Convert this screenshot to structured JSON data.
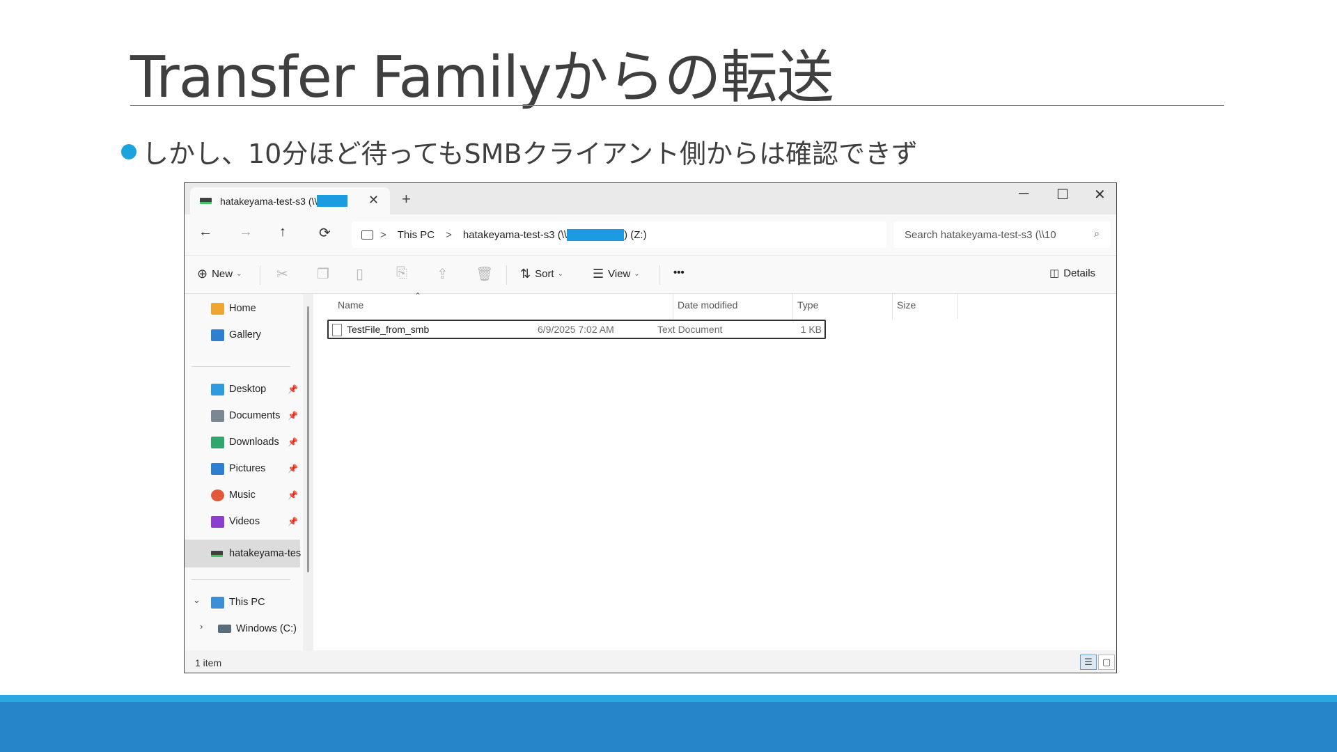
{
  "slide": {
    "title": "Transfer Familyからの転送",
    "bullet": "しかし、10分ほど待ってもSMBクライアント側からは確認できず"
  },
  "window": {
    "tab": {
      "title": "hatakeyama-test-s3 (\\\\",
      "close": "✕",
      "new_tab": "+"
    },
    "controls": {
      "minimize": "─",
      "maximize": "☐",
      "close": "✕"
    },
    "nav": {
      "back": "←",
      "forward": "→",
      "up": "↑",
      "refresh": "⟳"
    },
    "address": {
      "this_pc": "This PC",
      "separator": ">",
      "drive_prefix": "hatakeyama-test-s3 (\\\\",
      "drive_suffix": ") (Z:)"
    },
    "search": {
      "placeholder": "Search hatakeyama-test-s3 (\\\\10",
      "icon": "⌕"
    },
    "commands": {
      "new": "New",
      "sort": "Sort",
      "view": "View",
      "more": "•••",
      "details": "Details"
    },
    "sidebar": {
      "quick": [
        {
          "label": "Home",
          "icon": "home-icon",
          "color": "#f0a431"
        },
        {
          "label": "Gallery",
          "icon": "gallery-icon",
          "color": "#2f7fd0"
        }
      ],
      "pinned": [
        {
          "label": "Desktop",
          "icon": "desktop-icon",
          "color": "#2e9be0"
        },
        {
          "label": "Documents",
          "icon": "documents-icon",
          "color": "#7b8894"
        },
        {
          "label": "Downloads",
          "icon": "downloads-icon",
          "color": "#2fa66b"
        },
        {
          "label": "Pictures",
          "icon": "pictures-icon",
          "color": "#2f7fd0"
        },
        {
          "label": "Music",
          "icon": "music-icon",
          "color": "#e05a3a"
        },
        {
          "label": "Videos",
          "icon": "videos-icon",
          "color": "#8a3fd1"
        }
      ],
      "selected": "hatakeyama-tes",
      "this_pc": "This PC",
      "windows_c": "Windows (C:)"
    },
    "columns": {
      "name": "Name",
      "date": "Date modified",
      "type": "Type",
      "size": "Size"
    },
    "files": [
      {
        "name": "TestFile_from_smb",
        "date": "6/9/2025 7:02 AM",
        "type": "Text Document",
        "size": "1 KB"
      }
    ],
    "status": {
      "count": "1 item"
    }
  },
  "theme": {
    "accent": "#1aa3dd",
    "footer": "#2585c7",
    "footer_light": "#2aa9e0",
    "redaction": "#1b9be0"
  }
}
